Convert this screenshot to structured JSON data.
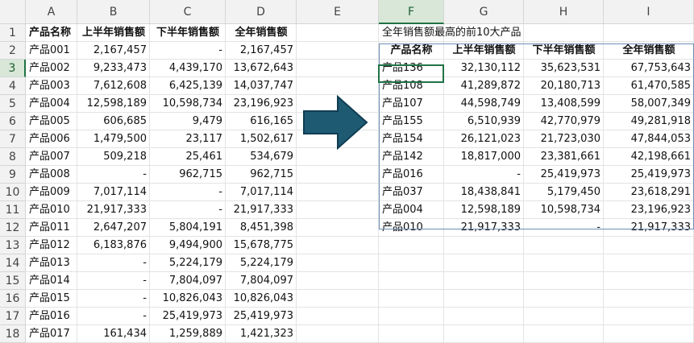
{
  "columns": [
    "A",
    "B",
    "C",
    "D",
    "E",
    "F",
    "G",
    "H",
    "I"
  ],
  "rows": [
    "1",
    "2",
    "3",
    "4",
    "5",
    "6",
    "7",
    "8",
    "9",
    "10",
    "11",
    "12",
    "13",
    "14",
    "15",
    "16",
    "17",
    "18"
  ],
  "source": {
    "headers": [
      "产品名称",
      "上半年销售额",
      "下半年销售额",
      "全年销售额"
    ],
    "data": [
      [
        "产品001",
        "2,167,457",
        "-",
        "2,167,457"
      ],
      [
        "产品002",
        "9,233,473",
        "4,439,170",
        "13,672,643"
      ],
      [
        "产品003",
        "7,612,608",
        "6,425,139",
        "14,037,747"
      ],
      [
        "产品004",
        "12,598,189",
        "10,598,734",
        "23,196,923"
      ],
      [
        "产品005",
        "606,685",
        "9,479",
        "616,165"
      ],
      [
        "产品006",
        "1,479,500",
        "23,117",
        "1,502,617"
      ],
      [
        "产品007",
        "509,218",
        "25,461",
        "534,679"
      ],
      [
        "产品008",
        "-",
        "962,715",
        "962,715"
      ],
      [
        "产品009",
        "7,017,114",
        "-",
        "7,017,114"
      ],
      [
        "产品010",
        "21,917,333",
        "-",
        "21,917,333"
      ],
      [
        "产品011",
        "2,647,207",
        "5,804,191",
        "8,451,398"
      ],
      [
        "产品012",
        "6,183,876",
        "9,494,900",
        "15,678,775"
      ],
      [
        "产品013",
        "-",
        "5,224,179",
        "5,224,179"
      ],
      [
        "产品014",
        "-",
        "7,804,097",
        "7,804,097"
      ],
      [
        "产品015",
        "-",
        "10,826,043",
        "10,826,043"
      ],
      [
        "产品016",
        "-",
        "25,419,973",
        "25,419,973"
      ],
      [
        "产品017",
        "161,434",
        "1,259,889",
        "1,421,323"
      ]
    ]
  },
  "result": {
    "title": "全年销售额最高的前10大产品",
    "headers": [
      "产品名称",
      "上半年销售额",
      "下半年销售额",
      "全年销售额"
    ],
    "data": [
      [
        "产品136",
        "32,130,112",
        "35,623,531",
        "67,753,643"
      ],
      [
        "产品108",
        "41,289,872",
        "20,180,713",
        "61,470,585"
      ],
      [
        "产品107",
        "44,598,749",
        "13,408,599",
        "58,007,349"
      ],
      [
        "产品155",
        "6,510,939",
        "42,770,979",
        "49,281,918"
      ],
      [
        "产品154",
        "26,121,023",
        "21,723,030",
        "47,844,053"
      ],
      [
        "产品142",
        "18,817,000",
        "23,381,661",
        "42,198,661"
      ],
      [
        "产品016",
        "-",
        "25,419,973",
        "25,419,973"
      ],
      [
        "产品037",
        "18,438,841",
        "5,179,450",
        "23,618,291"
      ],
      [
        "产品004",
        "12,598,189",
        "10,598,734",
        "23,196,923"
      ],
      [
        "产品010",
        "21,917,333",
        "-",
        "21,917,333"
      ]
    ]
  },
  "selection": {
    "column": "F",
    "row": "3"
  },
  "colors": {
    "accent": "#217346",
    "arrow": "#1f5a73",
    "table_border": "#6d8fb5"
  },
  "arrow_icon": "right-arrow-icon"
}
